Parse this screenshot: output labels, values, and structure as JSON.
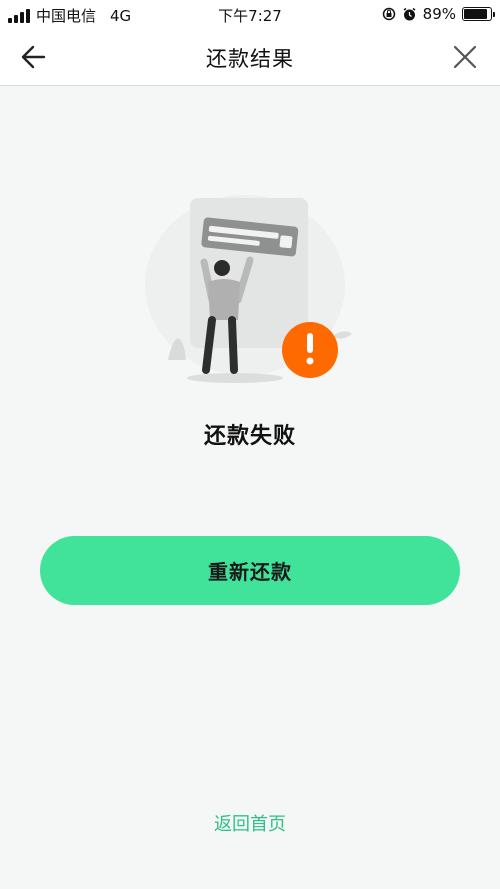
{
  "status_bar": {
    "carrier": "中国电信",
    "network": "4G",
    "time": "下午7:27",
    "battery": "89%",
    "battery_level": 0.89
  },
  "nav": {
    "title": "还款结果",
    "back_icon": "arrow-left-icon",
    "close_icon": "close-icon"
  },
  "result": {
    "illustration": "failure-illustration",
    "title": "还款失败"
  },
  "actions": {
    "retry_label": "重新还款",
    "home_label": "返回首页"
  },
  "colors": {
    "accent": "#41e39a",
    "link": "#2ec289",
    "alert": "#ff6a00",
    "background": "#f5f7f6"
  }
}
